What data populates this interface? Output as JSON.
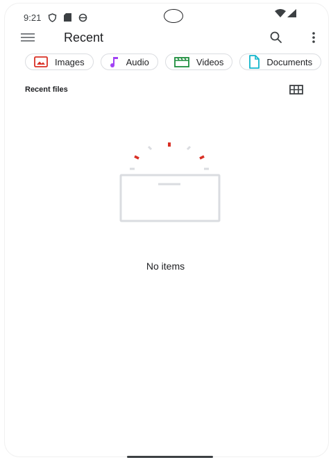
{
  "status_bar": {
    "time": "9:21"
  },
  "app_bar": {
    "title": "Recent"
  },
  "chips": [
    {
      "label": "Images",
      "icon": "image-icon",
      "color": "#d93025"
    },
    {
      "label": "Audio",
      "icon": "music-note-icon",
      "color": "#a142f4"
    },
    {
      "label": "Videos",
      "icon": "video-icon",
      "color": "#1e8e3e"
    },
    {
      "label": "Documents",
      "icon": "document-icon",
      "color": "#12b5cb"
    }
  ],
  "section": {
    "label": "Recent files"
  },
  "empty_state": {
    "text": "No items"
  },
  "colors": {
    "accent_red": "#d93025",
    "outline": "#dadce0"
  }
}
